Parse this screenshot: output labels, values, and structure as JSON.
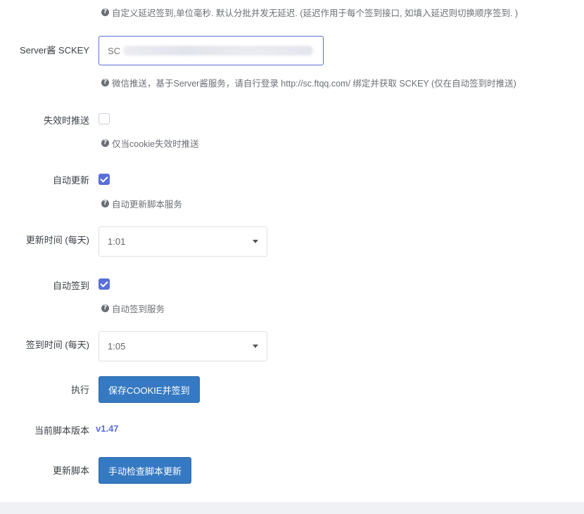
{
  "delay_help": "自定义延迟签到,单位毫秒. 默认分批并发无延迟. (延迟作用于每个签到接口, 如填入延迟则切换顺序签到. )",
  "sckey": {
    "label": "Server酱 SCKEY",
    "value": "SC",
    "help": "微信推送，基于Server酱服务，请自行登录 http://sc.ftqq.com/ 绑定并获取 SCKEY (仅在自动签到时推送)"
  },
  "push_on_expire": {
    "label": "失效时推送",
    "checked": false,
    "help": "仅当cookie失效时推送"
  },
  "auto_update": {
    "label": "自动更新",
    "checked": true,
    "help": "自动更新脚本服务"
  },
  "update_time": {
    "label": "更新时间 (每天)",
    "value": "1:01"
  },
  "auto_checkin": {
    "label": "自动签到",
    "checked": true,
    "help": "自动签到服务"
  },
  "checkin_time": {
    "label": "签到时间 (每天)",
    "value": "1:05"
  },
  "execute": {
    "label": "执行",
    "button": "保存COOKIE并签到"
  },
  "script_version": {
    "label": "当前脚本版本",
    "value": "v1.47"
  },
  "update_script": {
    "label": "更新脚本",
    "button": "手动检查脚本更新"
  },
  "colors": {
    "accent": "#5b6fd8",
    "button": "#3579c2"
  },
  "icons": {
    "help": "question-circle-icon",
    "select": "caret-down-icon"
  }
}
